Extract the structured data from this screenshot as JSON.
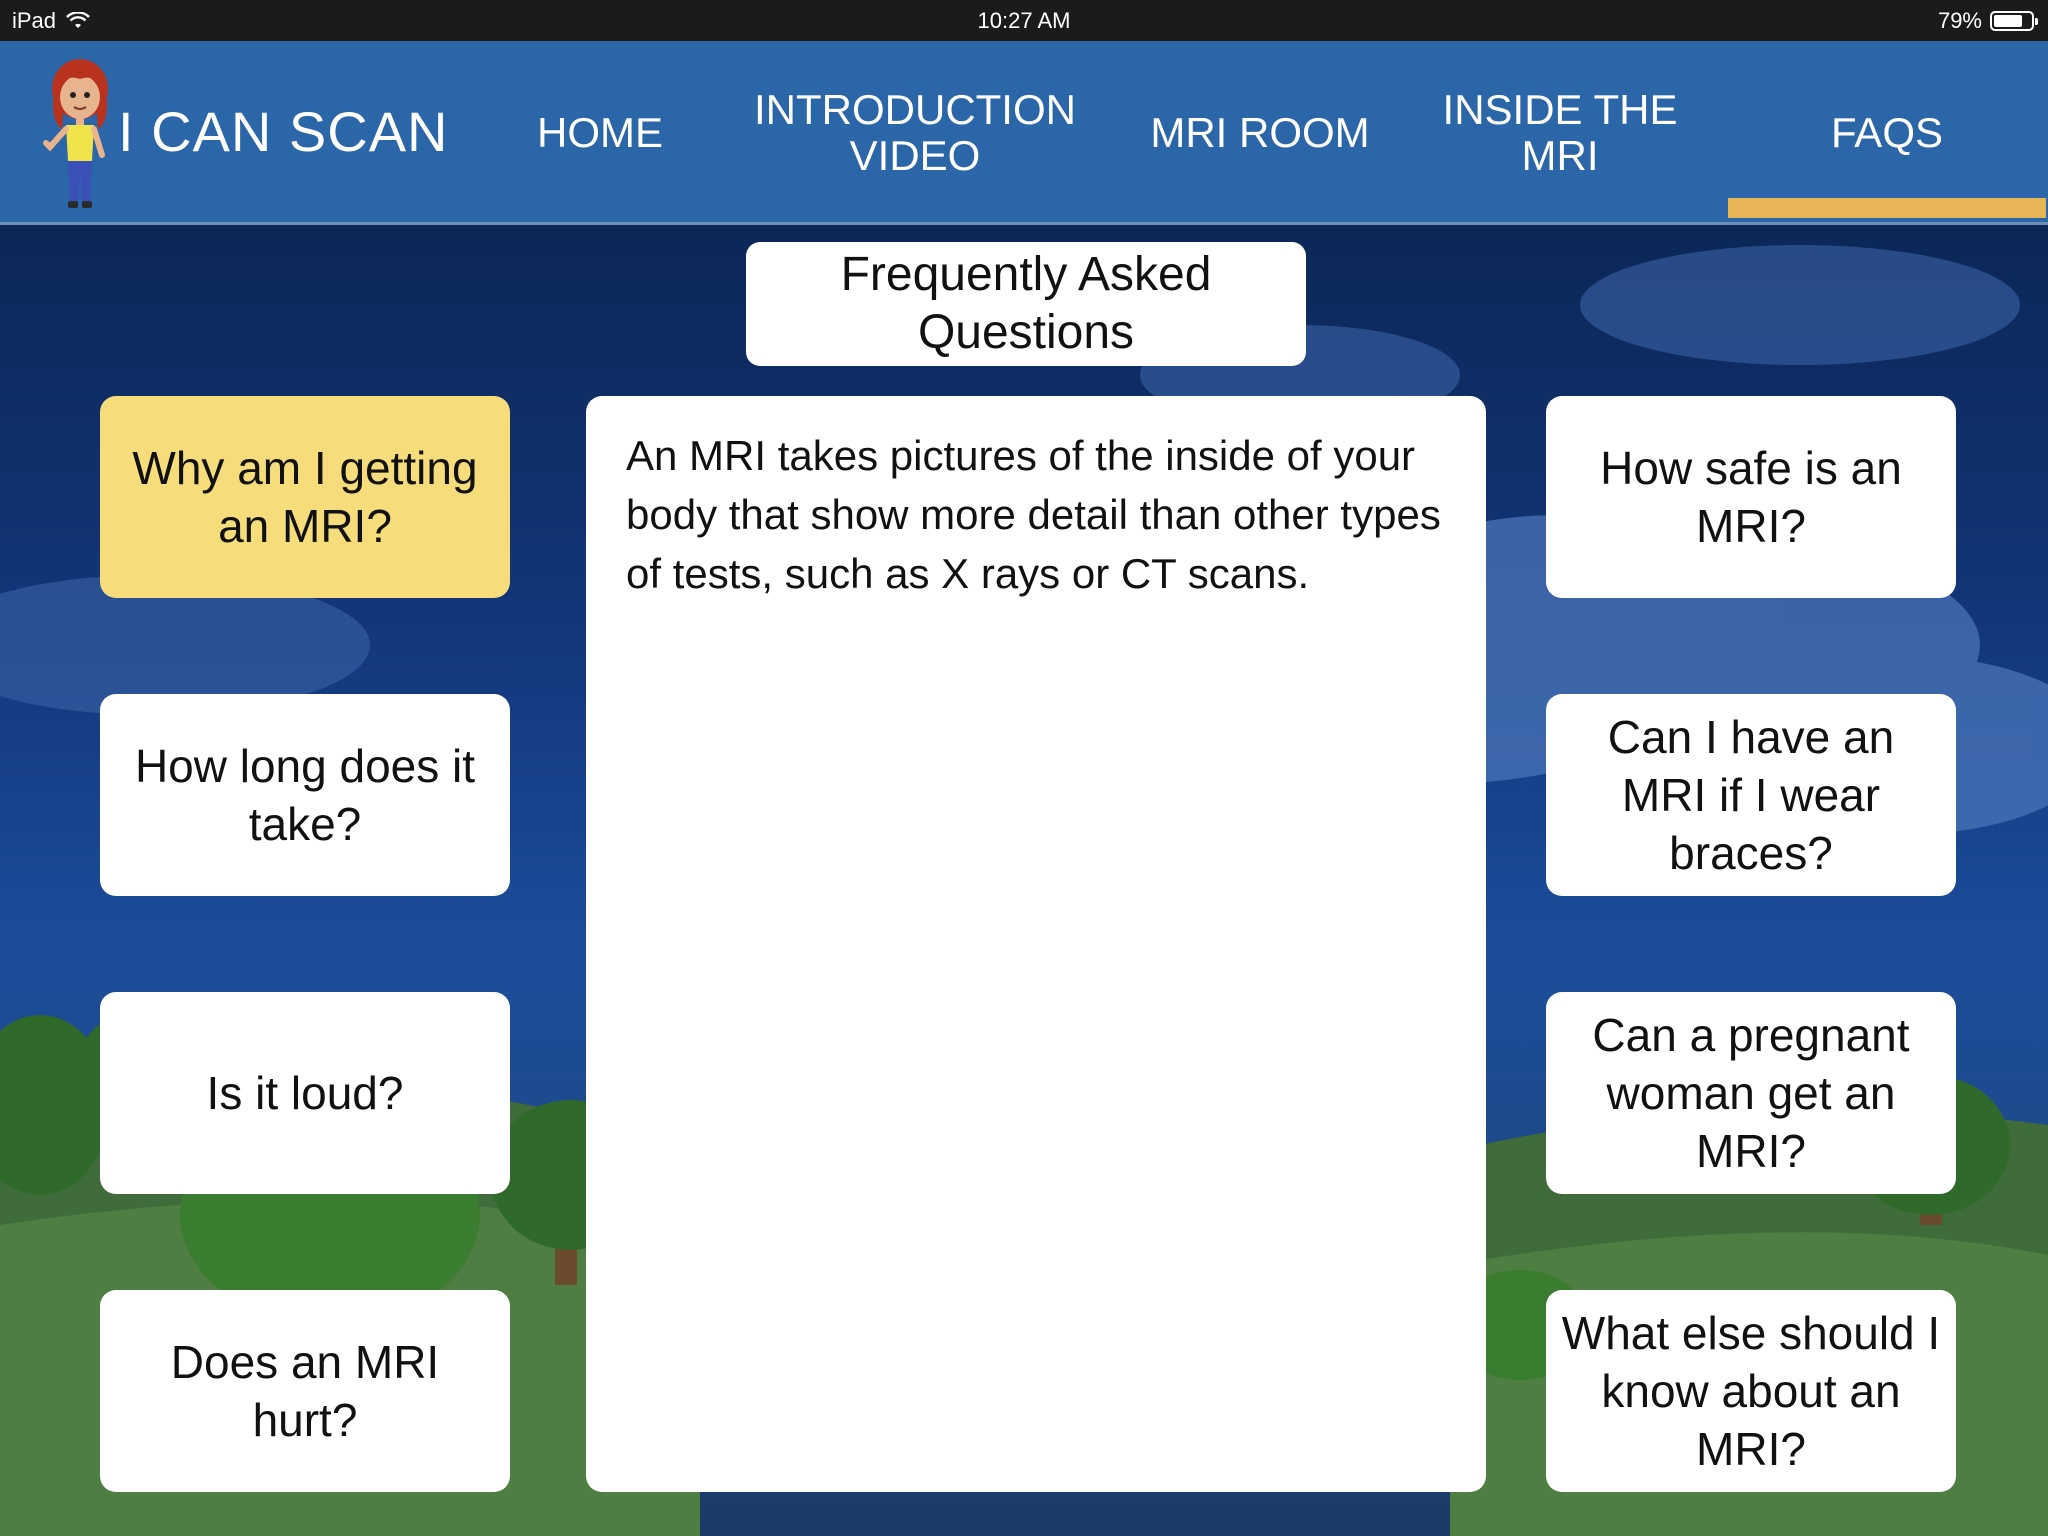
{
  "status_bar": {
    "device": "iPad",
    "time": "10:27 AM",
    "battery": "79%",
    "battery_level": 0.79,
    "wifi_icon": "wifi-icon",
    "battery_icon": "battery-icon"
  },
  "header": {
    "app_title": "I CAN SCAN",
    "logo_icon": "cartoon-girl-mascot",
    "nav": [
      {
        "label": "HOME",
        "active": false
      },
      {
        "label": "INTRODUCTION\nVIDEO",
        "active": false
      },
      {
        "label": "MRI ROOM",
        "active": false
      },
      {
        "label": "INSIDE THE\nMRI",
        "active": false
      },
      {
        "label": "FAQS",
        "active": true
      }
    ],
    "colors": {
      "bar": "#2a66a8",
      "active_indicator": "#e7b456"
    }
  },
  "main": {
    "page_title": "Frequently Asked Questions",
    "left_questions": [
      {
        "label": "Why am I getting an MRI?",
        "active": true
      },
      {
        "label": "How long does it take?",
        "active": false
      },
      {
        "label": "Is it loud?",
        "active": false
      },
      {
        "label": "Does an MRI hurt?",
        "active": false
      }
    ],
    "right_questions": [
      {
        "label": "How safe is an MRI?",
        "active": false
      },
      {
        "label": "Can I have an MRI if I wear braces?",
        "active": false
      },
      {
        "label": "Can a pregnant woman get an MRI?",
        "active": false
      },
      {
        "label": "What else should I know about an MRI?",
        "active": false
      }
    ],
    "answer_text": "An MRI takes pictures of the inside of your body that show more detail than other types of tests, such as X rays or CT scans.",
    "colors": {
      "active_question": "#f7dc7c",
      "card": "#ffffff"
    }
  }
}
